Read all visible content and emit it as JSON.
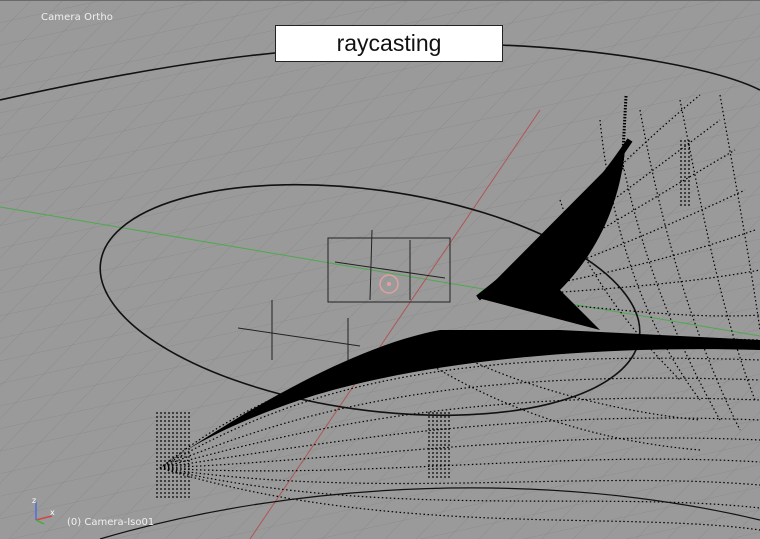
{
  "viewport": {
    "view_name": "Camera Ortho",
    "object_info": "(0) Camera-Iso01",
    "overlay_title": "raycasting",
    "axis_labels": {
      "z": "z",
      "x": "x"
    },
    "colors": {
      "background": "#9a9a9a",
      "grid": "#8a8a8a",
      "x_axis": "#b05555",
      "y_axis": "#4fa84f",
      "geometry": "#000000",
      "lamp": "#e0a0a0"
    }
  }
}
